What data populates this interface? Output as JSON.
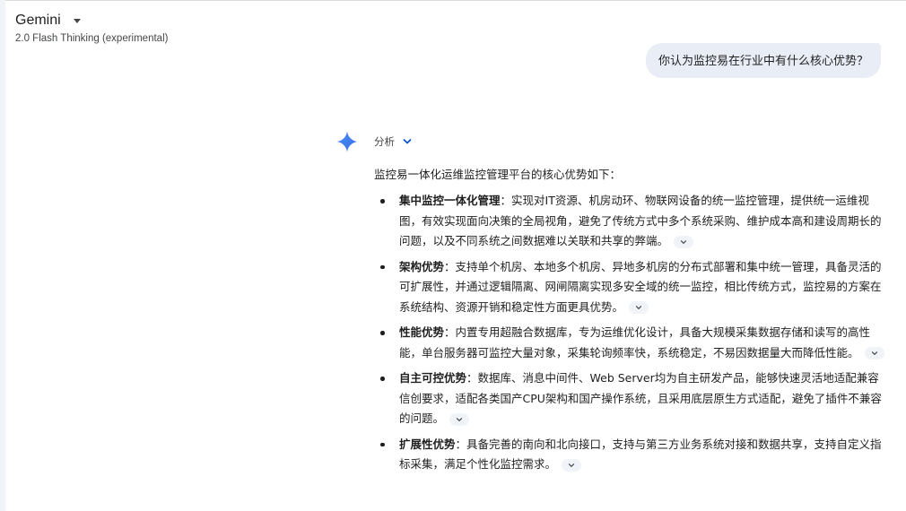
{
  "header": {
    "model_name": "Gemini",
    "model_subtitle": "2.0 Flash Thinking (experimental)"
  },
  "user_message": "你认为监控易在行业中有什么核心优势？",
  "response": {
    "analysis_label": "分析",
    "intro": "监控易一体化运维监控管理平台的核心优势如下：",
    "points": [
      {
        "title": "集中监控一体化管理",
        "text": "：实现对IT资源、机房动环、物联网设备的统一监控管理，提供统一运维视图，有效实现面向决策的全局视角，避免了传统方式中多个系统采购、维护成本高和建设周期长的问题，以及不同系统之间数据难以关联和共享的弊端。"
      },
      {
        "title": "架构优势",
        "text": "：支持单个机房、本地多个机房、异地多机房的分布式部署和集中统一管理，具备灵活的可扩展性，并通过逻辑隔离、网闸隔离实现多安全域的统一监控，相比传统方式，监控易的方案在系统结构、资源开销和稳定性方面更具优势。"
      },
      {
        "title": "性能优势",
        "text": "：内置专用超融合数据库，专为运维优化设计，具备大规模采集数据存储和读写的高性能，单台服务器可监控大量对象，采集轮询频率快，系统稳定，不易因数据量大而降低性能。"
      },
      {
        "title": "自主可控优势",
        "text": "：数据库、消息中间件、Web Server均为自主研发产品，能够快速灵活地适配兼容信创要求，适配各类国产CPU架构和国产操作系统，且采用底层原生方式适配，避免了插件不兼容的问题。"
      },
      {
        "title": "扩展性优势",
        "text": "：具备完善的南向和北向接口，支持与第三方业务系统对接和数据共享，支持自定义指标采集，满足个性化监控需求。"
      }
    ]
  },
  "icons": {
    "gemini": "gemini-sparkle-icon",
    "model_caret": "caret-down-icon",
    "analysis": "chevron-down-icon",
    "source_chip": "chevron-down-icon"
  },
  "colors": {
    "gemini_blue": "#4285f4",
    "user_bubble_bg": "#e9eef6",
    "chip_bg": "#f0f4f9",
    "text": "#1f1f1f"
  }
}
